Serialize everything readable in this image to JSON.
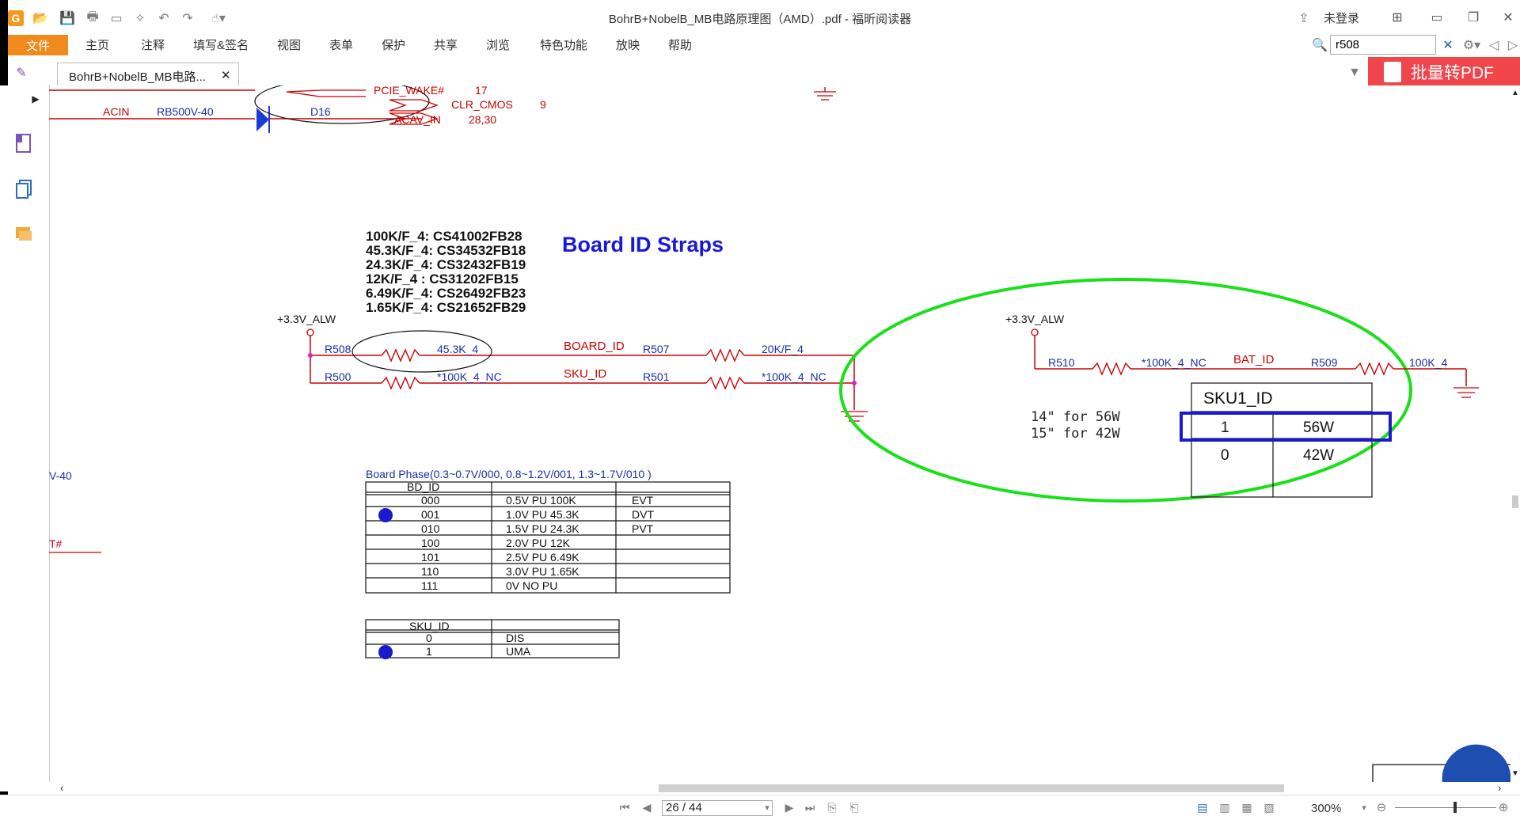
{
  "app": {
    "title": "BohrB+NobelB_MB电路原理图（AMD）.pdf - 福昕阅读器",
    "login": "未登录",
    "logo": "G"
  },
  "menu": {
    "items": [
      "文件",
      "主页",
      "注释",
      "填写&签名",
      "视图",
      "表单",
      "保护",
      "共享",
      "浏览",
      "特色功能",
      "放映",
      "帮助"
    ]
  },
  "search": {
    "value": "r508"
  },
  "tab": {
    "label": "BohrB+NobelB_MB电路...",
    "close": "✕"
  },
  "batch_pdf": {
    "label": "批量转PDF"
  },
  "schematic": {
    "top": {
      "pcie_wake": "PCIE_WAKE#",
      "pcie_wake_num": "17",
      "clr_cmos": "CLR_CMOS",
      "clr_cmos_num": "9",
      "acin": "ACIN",
      "rb500v": "RB500V-40",
      "d16": "D16",
      "acav_in": "ACAV_IN",
      "acav_num": "28,30"
    },
    "part_list": [
      "100K/F_4: CS41002FB28",
      "45.3K/F_4: CS34532FB18",
      "24.3K/F_4: CS32432FB19",
      "12K/F_4  : CS31202FB15",
      "6.49K/F_4: CS26492FB23",
      "1.65K/F_4: CS21652FB29"
    ],
    "heading": "Board ID Straps",
    "left_circuit": {
      "rail": "+3.3V_ALW",
      "r508": "R508",
      "r508_val": "45.3K_4",
      "board_id": "BOARD_ID",
      "r507": "R507",
      "r507_val": "20K/F_4",
      "r500": "R500",
      "r500_val": "*100K_4_NC",
      "sku_id": "SKU_ID",
      "r501": "R501",
      "r501_val": "*100K_4_NC"
    },
    "right_circuit": {
      "rail": "+3.3V_ALW",
      "r510": "R510",
      "r510_val": "*100K_4_NC",
      "bat_id": "BAT_ID",
      "r509": "R509",
      "r509_val": "100K_4",
      "note1": "14\" for 56W",
      "note2": "15\" for 42W",
      "sku1_title": "SKU1_ID",
      "sku1_rows": [
        [
          "1",
          "56W"
        ],
        [
          "0",
          "42W"
        ]
      ]
    },
    "fragments": {
      "v40": "V-40",
      "t_hash": "T#"
    },
    "board_phase": {
      "caption": "Board Phase(0.3~0.7V/000, 0.8~1.2V/001, 1.3~1.7V/010 )",
      "header": "BD_ID",
      "rows": [
        [
          "000",
          "0.5V  PU 100K",
          "EVT"
        ],
        [
          "001",
          "1.0V  PU 45.3K",
          "DVT"
        ],
        [
          "010",
          "1.5V  PU 24.3K",
          "PVT"
        ],
        [
          "100",
          "2.0V  PU 12K",
          ""
        ],
        [
          "101",
          "2.5V  PU 6.49K",
          ""
        ],
        [
          "110",
          "3.0V  PU 1.65K",
          ""
        ],
        [
          "111",
          "0V  NO PU",
          ""
        ]
      ]
    },
    "sku_table": {
      "header": "SKU_ID",
      "rows": [
        [
          "0",
          "DIS"
        ],
        [
          "1",
          "UMA"
        ]
      ]
    }
  },
  "status": {
    "page": "26 / 44",
    "zoom": "300%"
  }
}
